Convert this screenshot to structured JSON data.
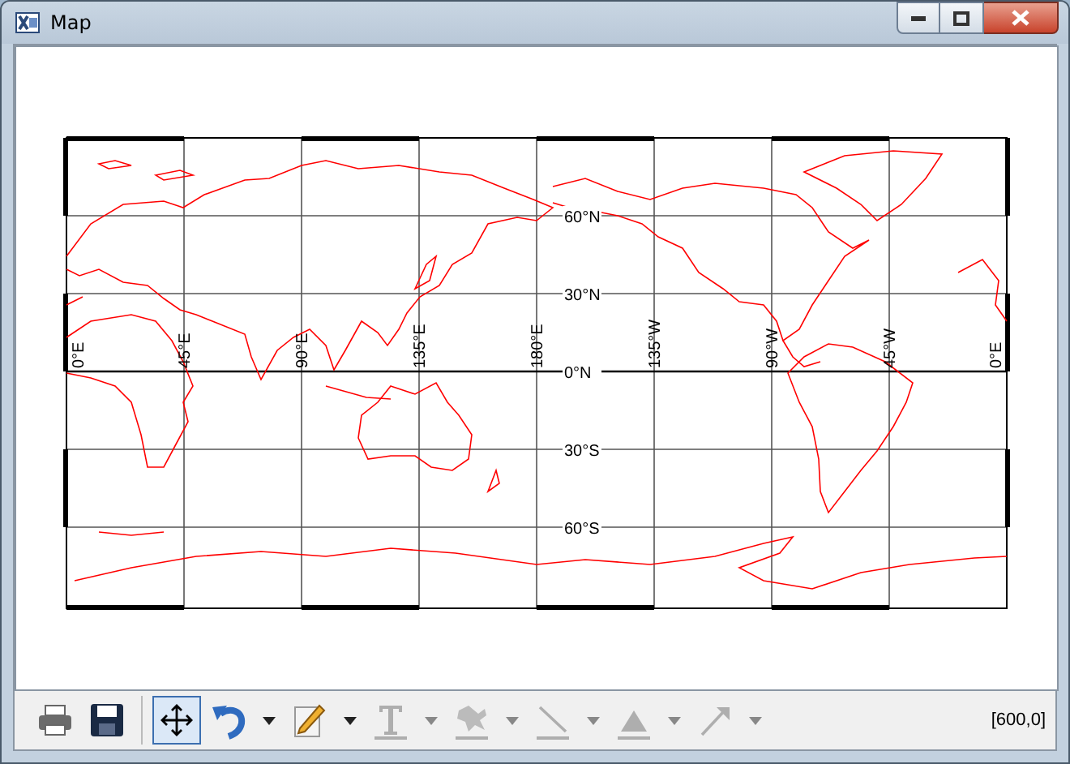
{
  "window": {
    "title": "Map"
  },
  "map": {
    "longitude_labels": [
      "0°E",
      "45°E",
      "90°E",
      "135°E",
      "180°E",
      "135°W",
      "90°W",
      "45°W",
      "0°E"
    ],
    "latitude_labels": [
      "60°N",
      "30°N",
      "0°N",
      "30°S",
      "60°S"
    ]
  },
  "toolbar": {
    "tools": [
      {
        "kind": "print",
        "disabled": false,
        "selected": false,
        "dropdown": false
      },
      {
        "kind": "save",
        "disabled": false,
        "selected": false,
        "dropdown": false
      },
      {
        "kind": "fit",
        "disabled": false,
        "selected": true,
        "dropdown": false
      },
      {
        "kind": "undo",
        "disabled": false,
        "selected": false,
        "dropdown": true
      },
      {
        "kind": "edit",
        "disabled": false,
        "selected": false,
        "dropdown": true
      },
      {
        "kind": "text",
        "disabled": true,
        "selected": false,
        "dropdown": true
      },
      {
        "kind": "brush",
        "disabled": true,
        "selected": false,
        "dropdown": true
      },
      {
        "kind": "line",
        "disabled": true,
        "selected": false,
        "dropdown": true
      },
      {
        "kind": "triangle",
        "disabled": true,
        "selected": false,
        "dropdown": true
      },
      {
        "kind": "arrow",
        "disabled": true,
        "selected": false,
        "dropdown": true
      }
    ]
  },
  "status_bar": {
    "coordinates": "[600,0]"
  }
}
